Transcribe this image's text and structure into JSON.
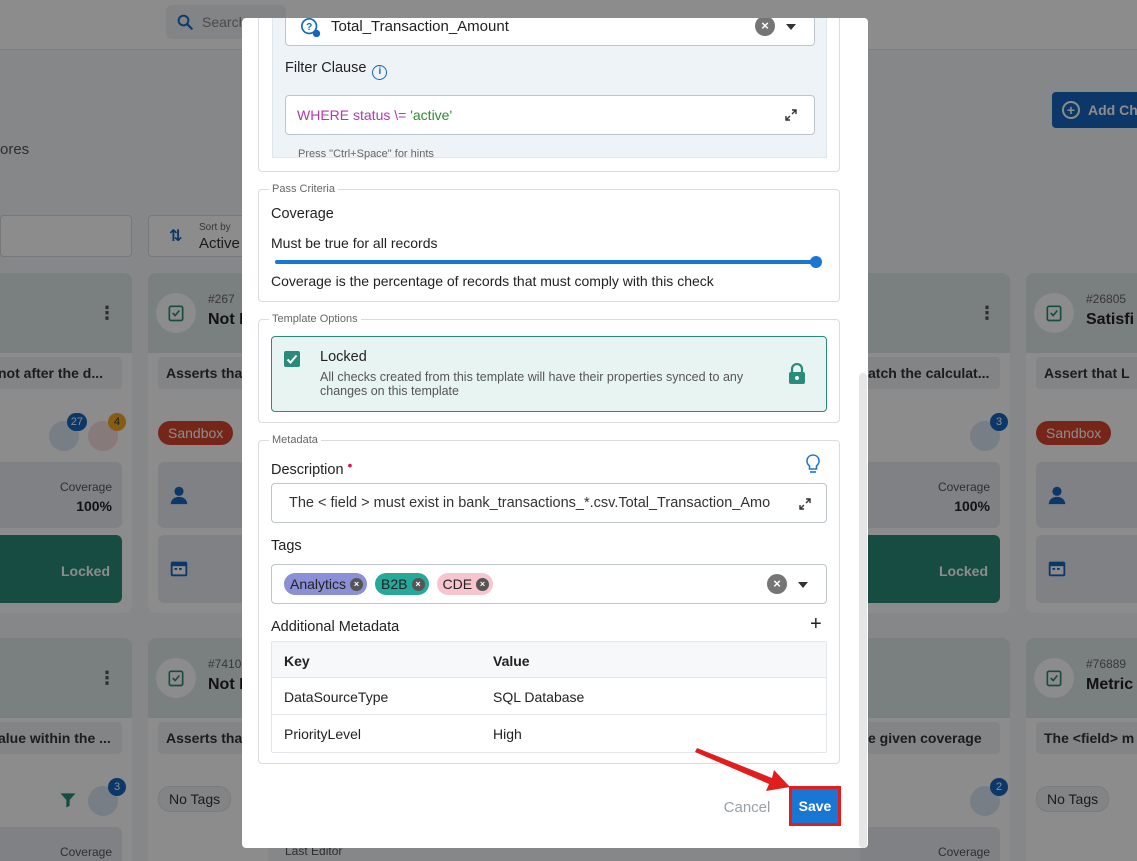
{
  "background": {
    "search_placeholder": "Search",
    "add_button_label": "Add Ch",
    "stores_text": "ores",
    "sort_by_label": "Sort by",
    "sort_by_value": "Active",
    "cards_row1": [
      {
        "title": "",
        "desc": "not after the d...",
        "badge1": "27",
        "badge2": "4",
        "stat_label": "Coverage",
        "stat_value": "100%",
        "locked": "Locked"
      },
      {
        "num": "#267",
        "title": "Not I",
        "desc": "Asserts tha",
        "tag": "Sandbox"
      },
      {
        "title": "",
        "desc": "atch the calculat...",
        "badge1": "3",
        "stat_label": "Coverage",
        "stat_value": "100%",
        "locked": "Locked"
      },
      {
        "num": "#26805",
        "title": "Satisfi",
        "desc": "Assert that L",
        "tag": "Sandbox"
      }
    ],
    "cards_row2": [
      {
        "title": "",
        "desc": "alue within the ...",
        "badge1": "3",
        "stat_label": "Coverage"
      },
      {
        "num": "#7410",
        "title": "Not I",
        "desc": "Asserts tha",
        "tag": "No Tags",
        "stat_label": "Last Editor"
      },
      {
        "title": "",
        "desc": "e given coverage",
        "badge1": "2",
        "stat_label": "Coverage"
      },
      {
        "num": "#76889",
        "title": "Metric",
        "desc": "The <field> m",
        "tag": "No Tags",
        "stat_label": "Coverage"
      }
    ],
    "row2_mid_labels": {
      "coverage": "Coverage",
      "last_editor": "Last Editor"
    }
  },
  "modal": {
    "field_select_value": "Total_Transaction_Amount",
    "filter_clause_label": "Filter Clause",
    "filter_clause": {
      "kw1": "WHERE status",
      "op": " \\= ",
      "val": "'active'"
    },
    "filter_hint": "Press \"Ctrl+Space\" for hints",
    "pass_criteria": {
      "legend": "Pass Criteria",
      "title": "Coverage",
      "subtitle": "Must be true for all records",
      "slider_value_percent": 100,
      "helper": "Coverage is the percentage of records that must comply with this check"
    },
    "template_options": {
      "legend": "Template Options",
      "checked": true,
      "title": "Locked",
      "description": "All checks created from this template will have their properties synced to any changes on this template"
    },
    "metadata": {
      "legend": "Metadata",
      "description_label": "Description",
      "description_value": "The < field > must exist in bank_transactions_*.csv.Total_Transaction_Amo",
      "tags_label": "Tags",
      "tags": [
        {
          "label": "Analytics",
          "color": "#8a8fd6"
        },
        {
          "label": "B2B",
          "color": "#26a99a"
        },
        {
          "label": "CDE",
          "color": "#f7c5d0"
        }
      ],
      "additional_label": "Additional Metadata",
      "add_symbol": "+",
      "table_headers": {
        "key": "Key",
        "value": "Value"
      },
      "rows": [
        {
          "key": "DataSourceType",
          "value": "SQL Database"
        },
        {
          "key": "PriorityLevel",
          "value": "High"
        }
      ]
    },
    "cancel_label": "Cancel",
    "save_label": "Save"
  },
  "colors": {
    "primary": "#1976d2",
    "teal": "#2a8b7a",
    "sandbox": "#d6452f",
    "highlight": "#e01e1e",
    "required_dot": "#e0115f",
    "sql_keyword": "#b03ab0",
    "sql_string": "#2e8b2e"
  },
  "icons": [
    "search-icon",
    "help-settings-icon",
    "info-icon",
    "lock-icon",
    "bulb-icon",
    "expand-icon",
    "close-icon",
    "chevron-down-icon",
    "check-icon",
    "plus-icon"
  ]
}
